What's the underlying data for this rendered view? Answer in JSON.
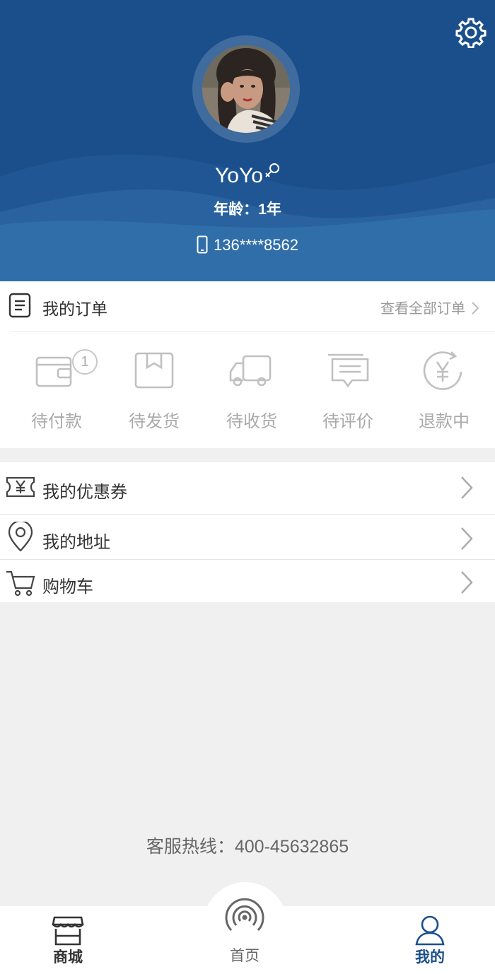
{
  "profile": {
    "username": "YoYo",
    "age": "年龄：1年",
    "phone": "136****8562"
  },
  "orders": {
    "title": "我的订单",
    "view_all": "查看全部订单",
    "statuses": [
      {
        "label": "待付款",
        "icon": "wallet-icon",
        "badge": "1"
      },
      {
        "label": "待发货",
        "icon": "package-icon"
      },
      {
        "label": "待收货",
        "icon": "truck-icon"
      },
      {
        "label": "待评价",
        "icon": "comment-icon"
      },
      {
        "label": "退款中",
        "icon": "refund-icon"
      }
    ]
  },
  "menu": {
    "items": [
      {
        "label": "我的优惠券",
        "icon": "coupon-icon"
      },
      {
        "label": "我的地址",
        "icon": "location-pin-icon"
      },
      {
        "label": "购物车",
        "icon": "cart-icon"
      }
    ]
  },
  "hotline": "客服热线：400-45632865",
  "tabbar": {
    "items": [
      {
        "label": "商城",
        "icon": "store-icon"
      },
      {
        "label": "首页",
        "icon": "signal-icon"
      },
      {
        "label": "我的",
        "icon": "user-icon",
        "active": true
      }
    ]
  },
  "colors": {
    "header_bg": "#1b4f8c",
    "header_wave": "#2e6aa3",
    "active_tab": "#1b4f8c",
    "muted_text": "#999999"
  }
}
